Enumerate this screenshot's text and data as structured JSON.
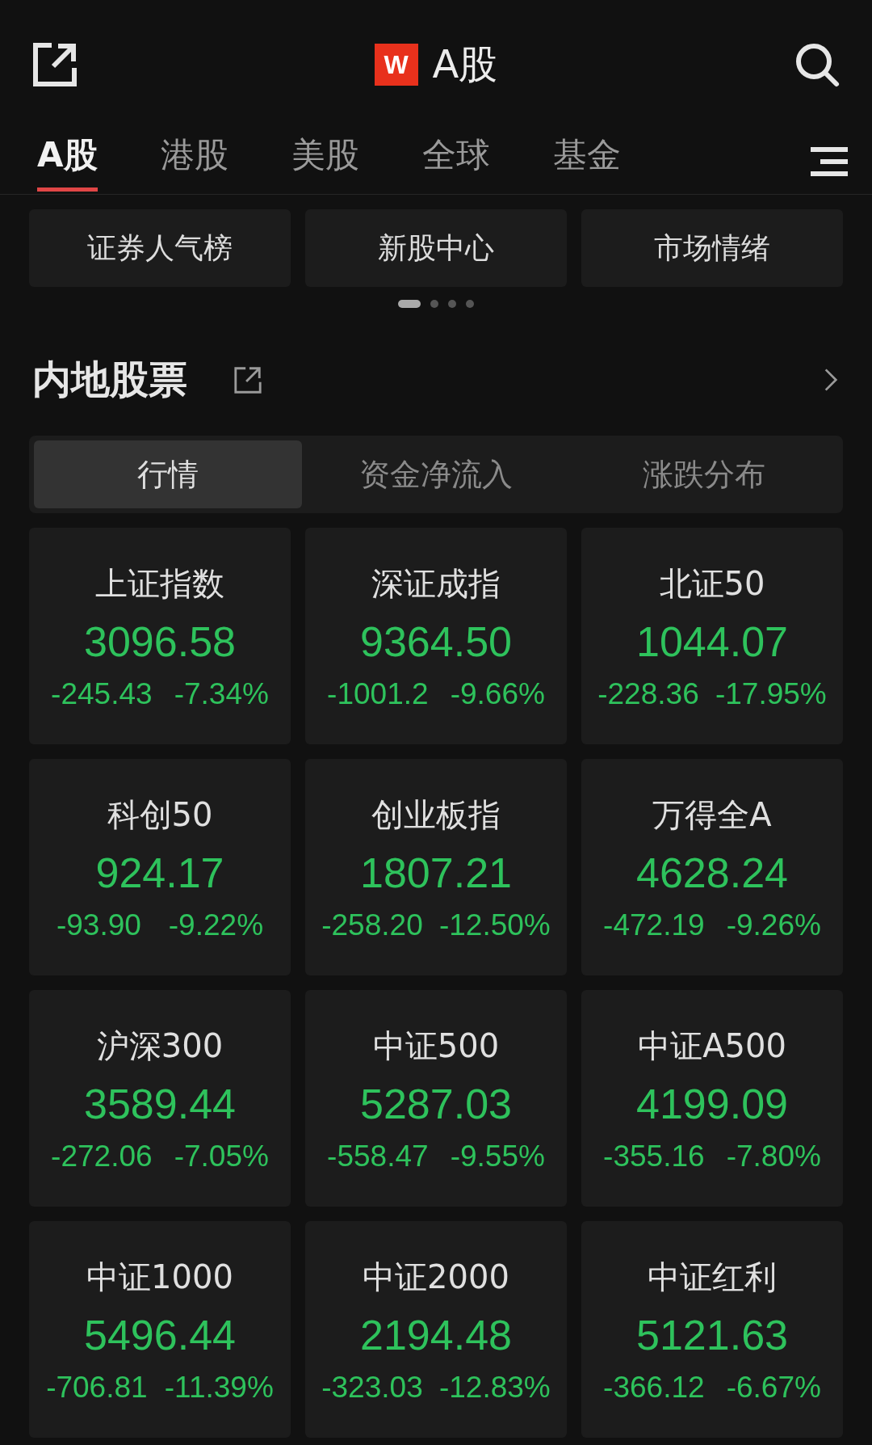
{
  "header": {
    "logo": "W",
    "title": "A股"
  },
  "tabs": [
    {
      "label": "A股",
      "selected": true
    },
    {
      "label": "港股",
      "selected": false
    },
    {
      "label": "美股",
      "selected": false
    },
    {
      "label": "全球",
      "selected": false
    },
    {
      "label": "基金",
      "selected": false
    }
  ],
  "shortcuts": [
    "证券人气榜",
    "新股中心",
    "市场情绪"
  ],
  "pager": [
    {
      "selected": true
    },
    {
      "selected": false
    },
    {
      "selected": false
    },
    {
      "selected": false
    }
  ],
  "section": {
    "title": "内地股票"
  },
  "segments": [
    {
      "label": "行情",
      "selected": true
    },
    {
      "label": "资金净流入",
      "selected": false
    },
    {
      "label": "涨跌分布",
      "selected": false
    }
  ],
  "indices": [
    {
      "name": "上证指数",
      "value": "3096.58",
      "change": "-245.43",
      "percent": "-7.34%"
    },
    {
      "name": "深证成指",
      "value": "9364.50",
      "change": "-1001.2",
      "percent": "-9.66%"
    },
    {
      "name": "北证50",
      "value": "1044.07",
      "change": "-228.36",
      "percent": "-17.95%"
    },
    {
      "name": "科创50",
      "value": "924.17",
      "change": "-93.90",
      "percent": "-9.22%"
    },
    {
      "name": "创业板指",
      "value": "1807.21",
      "change": "-258.20",
      "percent": "-12.50%"
    },
    {
      "name": "万得全A",
      "value": "4628.24",
      "change": "-472.19",
      "percent": "-9.26%"
    },
    {
      "name": "沪深300",
      "value": "3589.44",
      "change": "-272.06",
      "percent": "-7.05%"
    },
    {
      "name": "中证500",
      "value": "5287.03",
      "change": "-558.47",
      "percent": "-9.55%"
    },
    {
      "name": "中证A500",
      "value": "4199.09",
      "change": "-355.16",
      "percent": "-7.80%"
    },
    {
      "name": "中证1000",
      "value": "5496.44",
      "change": "-706.81",
      "percent": "-11.39%"
    },
    {
      "name": "中证2000",
      "value": "2194.48",
      "change": "-323.03",
      "percent": "-12.83%"
    },
    {
      "name": "中证红利",
      "value": "5121.63",
      "change": "-366.12",
      "percent": "-6.67%"
    }
  ]
}
